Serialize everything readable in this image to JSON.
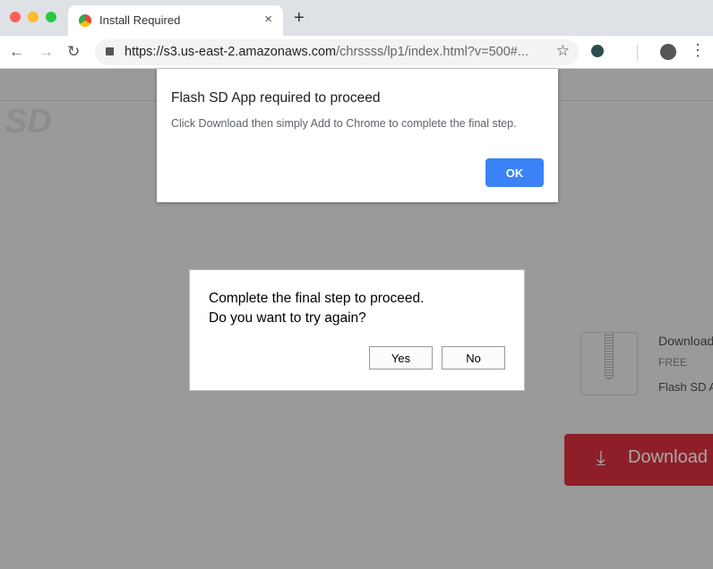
{
  "browser": {
    "tab_title": "Install Required",
    "url_host": "https://s3.us-east-2.amazonaws.com",
    "url_path": "/chrssss/lp1/index.html?v=500#...",
    "new_tab": "+",
    "close": "×"
  },
  "page": {
    "logo": "SD",
    "product_heading": "Download",
    "price": "FREE",
    "product_name": "Flash SD App",
    "download_button": "Download"
  },
  "alert_top": {
    "title": "Flash SD App required to proceed",
    "message": "Click Download then simply Add to Chrome to complete the final step.",
    "ok": "OK"
  },
  "alert_confirm": {
    "line1": "Complete the final step to proceed.",
    "line2": "Do you want to try again?",
    "yes": "Yes",
    "no": "No"
  }
}
